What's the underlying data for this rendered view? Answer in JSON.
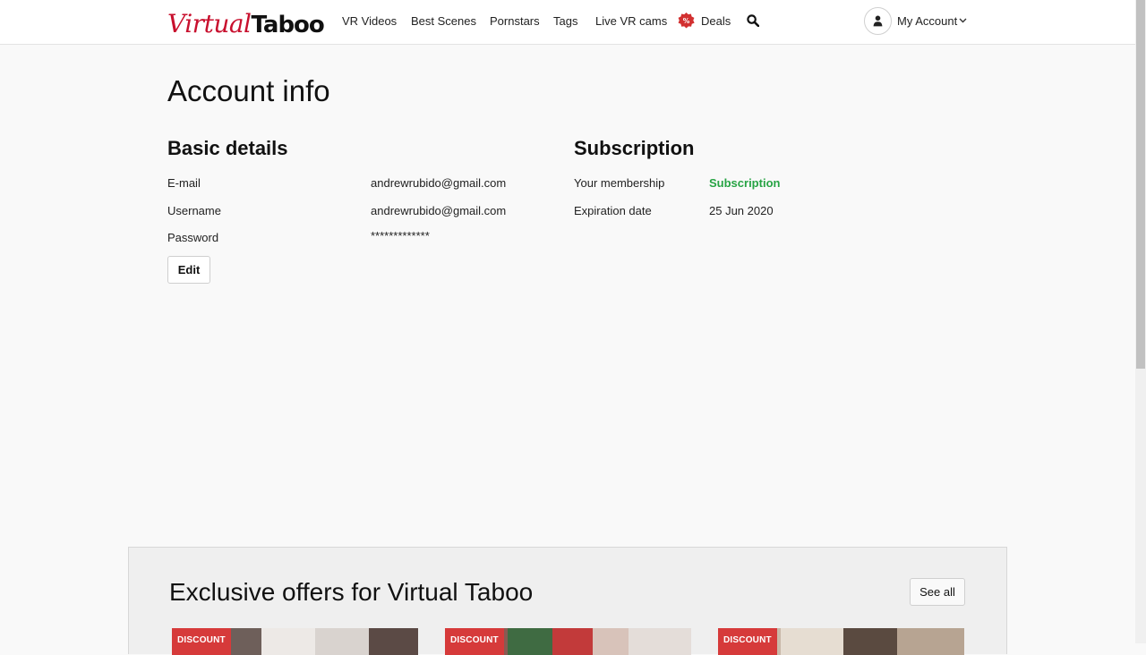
{
  "header": {
    "logo": {
      "part1": "Virtual",
      "part2": "Taboo"
    },
    "nav": [
      "VR Videos",
      "Best Scenes",
      "Pornstars",
      "Tags",
      "Live VR cams"
    ],
    "deals": {
      "badge": "%",
      "label": "Deals"
    },
    "account_label": "My Account"
  },
  "main": {
    "page_title": "Account info",
    "basic": {
      "title": "Basic details",
      "rows": [
        {
          "label": "E-mail",
          "value": "andrewrubido@gmail.com"
        },
        {
          "label": "Username",
          "value": "andrewrubido@gmail.com"
        },
        {
          "label": "Password",
          "value": "*************"
        }
      ],
      "edit_label": "Edit"
    },
    "subscription": {
      "title": "Subscription",
      "rows": [
        {
          "label": "Your membership",
          "value": "Subscription"
        },
        {
          "label": "Expiration date",
          "value": "25 Jun 2020"
        }
      ]
    }
  },
  "offers": {
    "title": "Exclusive offers for Virtual Taboo",
    "see_all": "See all",
    "cards": [
      {
        "badge": "DISCOUNT"
      },
      {
        "badge": "DISCOUNT"
      },
      {
        "badge": "DISCOUNT"
      }
    ]
  },
  "colors": {
    "brand_red": "#c8102e",
    "status_green": "#27a344",
    "badge_red": "#d63a3a"
  }
}
